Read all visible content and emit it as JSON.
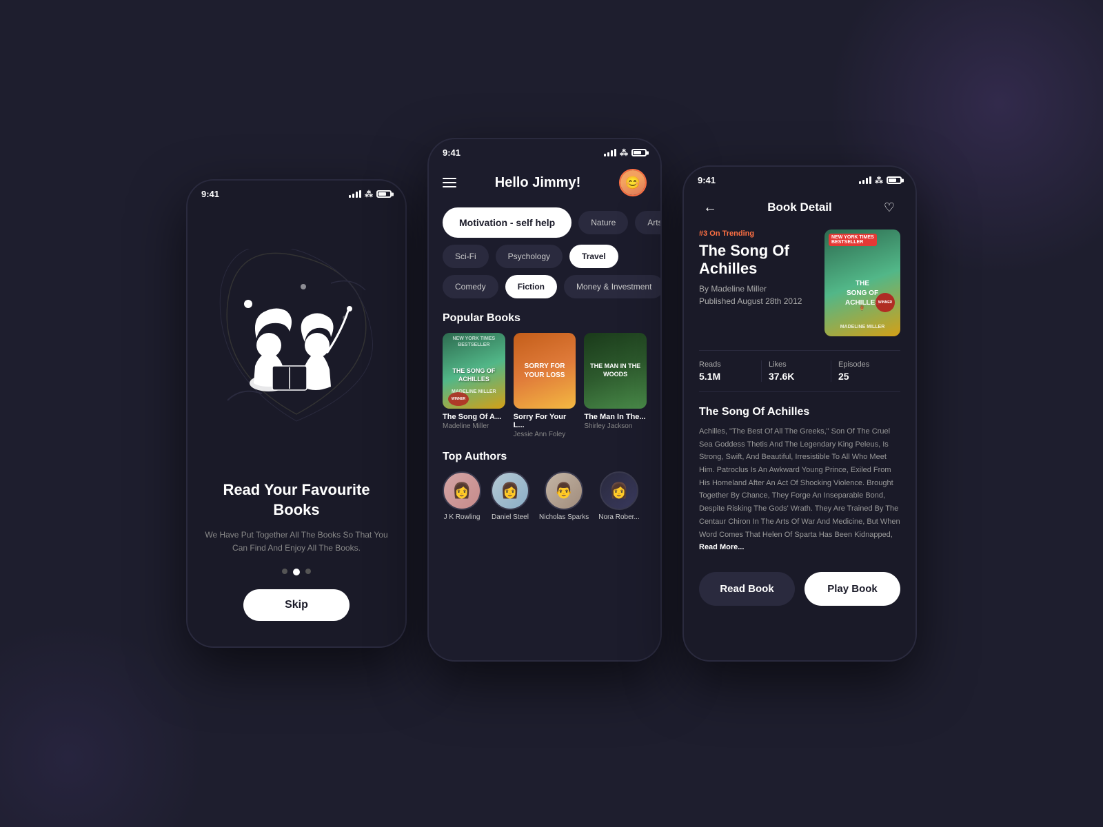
{
  "background": "#1e1e2e",
  "phone1": {
    "status_time": "9:41",
    "title": "Read Your Favourite Books",
    "subtitle": "We Have Put Together All The Books So That You Can Find And Enjoy All The Books.",
    "skip_label": "Skip",
    "dots": [
      "inactive",
      "active",
      "inactive"
    ]
  },
  "phone2": {
    "status_time": "9:41",
    "greeting": "Hello Jimmy!",
    "genres": [
      {
        "label": "Motivation - self help",
        "active": true,
        "size": "large"
      },
      {
        "label": "Nature",
        "active": false
      },
      {
        "label": "Arts",
        "active": false
      },
      {
        "label": "Sci-Fi",
        "active": false
      },
      {
        "label": "Psychology",
        "active": false
      },
      {
        "label": "Travel",
        "active": true
      },
      {
        "label": "Comedy",
        "active": false
      },
      {
        "label": "Fiction",
        "active": true
      },
      {
        "label": "Money & Investment",
        "active": false
      }
    ],
    "popular_books_title": "Popular Books",
    "books": [
      {
        "title": "The Song Of A...",
        "author": "Madeline Miller",
        "cover_text": "THE SONG OF ACHILLES"
      },
      {
        "title": "Sorry For Your L...",
        "author": "Jessie Ann Foley",
        "cover_text": "SORRY FOR YOUR LOSS"
      },
      {
        "title": "The Man In The...",
        "author": "Shirley Jackson",
        "cover_text": "THE MAN IN THE WOODS"
      }
    ],
    "top_authors_title": "Top Authors",
    "authors": [
      {
        "name": "J K Rowling",
        "emoji": "👩"
      },
      {
        "name": "Daniel Steel",
        "emoji": "👩"
      },
      {
        "name": "Nicholas Sparks",
        "emoji": "👨"
      },
      {
        "name": "Nora Rober...",
        "emoji": "👩"
      }
    ]
  },
  "phone3": {
    "status_time": "9:41",
    "header_title": "Book Detail",
    "trending_badge": "#3 On Trending",
    "book_title": "The Song Of Achilles",
    "book_author": "By Madeline Miller",
    "book_published": "Published August 28th 2012",
    "cover_badge": "NEW YORK TIMES BESTSELLER",
    "cover_text": "THE SONG OF ACHILLES",
    "stats": [
      {
        "label": "Reads",
        "value": "5.1M"
      },
      {
        "label": "Likes",
        "value": "37.6K"
      },
      {
        "label": "Episodes",
        "value": "25"
      }
    ],
    "description_title": "The Song Of Achilles",
    "description": "Achilles, \"The Best Of All The Greeks,\" Son Of The Cruel Sea Goddess Thetis And The Legendary King Peleus, Is Strong, Swift, And Beautiful, Irresistible To All Who Meet Him. Patroclus Is An Awkward Young Prince, Exiled From His Homeland After An Act Of Shocking Violence. Brought Together By Chance, They Forge An Inseparable Bond, Despite Risking The Gods' Wrath. They Are Trained By The Centaur Chiron In The Arts Of War And Medicine, But When Word Comes That Helen Of Sparta Has Been Kidnapped,",
    "read_more_label": "Read More...",
    "read_book_label": "Read Book",
    "play_book_label": "Play Book"
  }
}
